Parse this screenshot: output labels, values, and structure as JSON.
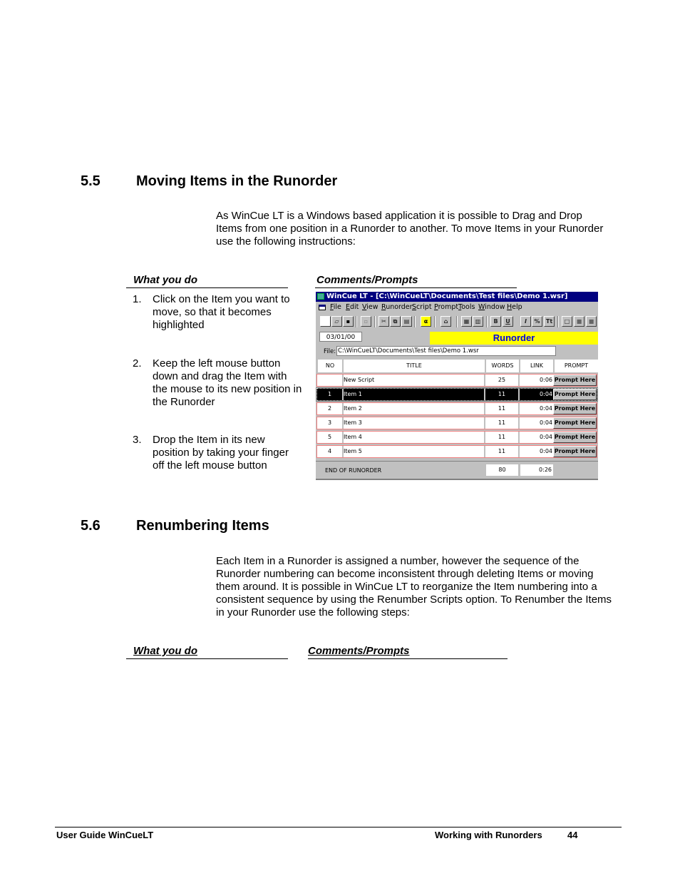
{
  "section_5_5": {
    "number": "5.5",
    "title": "Moving Items in the Runorder",
    "intro": "As WinCue LT is a Windows based application it is possible to Drag and Drop Items from one position in a Runorder to another. To move Items in your Runorder use the following instructions:",
    "col_what": "What you do",
    "col_comments": "Comments/Prompts",
    "steps": [
      {
        "n": "1.",
        "text": "Click on the Item you want to move, so that it becomes highlighted"
      },
      {
        "n": "2.",
        "text": "Keep the left mouse button down and drag the Item with the mouse to its new position in the Runorder"
      },
      {
        "n": "3.",
        "text": "Drop the Item in its new position by taking your finger off the left mouse button"
      }
    ]
  },
  "screenshot": {
    "title": "WinCue LT - [C:\\WinCueLT\\Documents\\Test files\\Demo 1.wsr]",
    "menu": [
      "File",
      "Edit",
      "View",
      "Runorder",
      "Script",
      "Prompt",
      "Tools",
      "Window",
      "Help"
    ],
    "toolbar": [
      {
        "icon": "new-file-icon",
        "glyph": ""
      },
      {
        "icon": "open-folder-icon",
        "glyph": "▱"
      },
      {
        "icon": "save-icon",
        "glyph": "▪"
      },
      {
        "icon": "save-disabled-icon",
        "glyph": "▫"
      },
      {
        "icon": "cut-icon",
        "glyph": "✂"
      },
      {
        "icon": "copy-icon",
        "glyph": "⧉"
      },
      {
        "icon": "paste-icon",
        "glyph": "▤"
      },
      {
        "icon": "alpha-icon",
        "glyph": "α"
      },
      {
        "icon": "prompter-icon",
        "glyph": "⌂"
      },
      {
        "icon": "layout-1-icon",
        "glyph": "▦"
      },
      {
        "icon": "layout-2-icon",
        "glyph": "▥"
      },
      {
        "icon": "bold-icon",
        "glyph": "B"
      },
      {
        "icon": "underline-icon",
        "glyph": "U"
      },
      {
        "icon": "italic-icon",
        "glyph": "I"
      },
      {
        "icon": "percent-icon",
        "glyph": "%"
      },
      {
        "icon": "text-style-icon",
        "glyph": "Tt"
      },
      {
        "icon": "frame-empty-icon",
        "glyph": "□"
      },
      {
        "icon": "frame-filled-icon",
        "glyph": "■"
      },
      {
        "icon": "frame-filled-2-icon",
        "glyph": "■"
      }
    ],
    "date": "03/01/00",
    "banner": "Runorder",
    "file_label": "File:",
    "file_path": "C:\\WinCueLT\\Documents\\Test files\\Demo 1.wsr",
    "columns": [
      "NO",
      "TITLE",
      "WORDS",
      "LINK",
      "PROMPT"
    ],
    "rows": [
      {
        "no": "",
        "title": "New Script",
        "words": "25",
        "link": "0:06",
        "prompt": "Prompt Here",
        "selected": false
      },
      {
        "no": "1",
        "title": "Item 1",
        "words": "11",
        "link": "0:04",
        "prompt": "Prompt Here",
        "selected": true
      },
      {
        "no": "2",
        "title": "Item 2",
        "words": "11",
        "link": "0:04",
        "prompt": "Prompt Here",
        "selected": false
      },
      {
        "no": "3",
        "title": "Item 3",
        "words": "11",
        "link": "0:04",
        "prompt": "Prompt Here",
        "selected": false
      },
      {
        "no": "5",
        "title": "Item 4",
        "words": "11",
        "link": "0:04",
        "prompt": "Prompt Here",
        "selected": false
      },
      {
        "no": "4",
        "title": "Item 5",
        "words": "11",
        "link": "0:04",
        "prompt": "Prompt Here",
        "selected": false
      }
    ],
    "end_label": "END OF RUNORDER",
    "end_words": "80",
    "end_link": "0:26"
  },
  "section_5_6": {
    "number": "5.6",
    "title": "Renumbering Items",
    "intro": "Each Item in a Runorder is assigned a number, however the sequence of the Runorder numbering can become inconsistent through deleting Items or moving them around. It is possible in WinCue LT to reorganize the Item numbering into a consistent sequence by using the Renumber Scripts option. To Renumber the Items in your Runorder use the following steps:",
    "col_what": "What you do",
    "col_comments": "Comments/Prompts"
  },
  "footer": {
    "left": "User Guide WinCueLT",
    "chapter": "Working with Runorders",
    "page": "44"
  }
}
